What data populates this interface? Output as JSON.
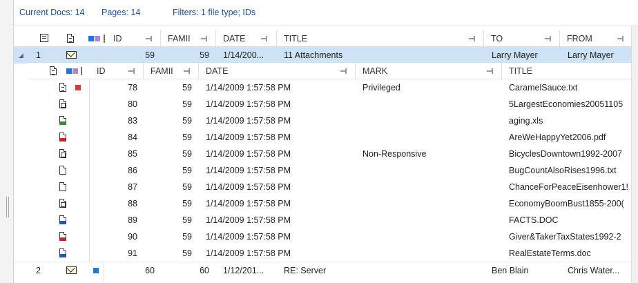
{
  "status": {
    "current_docs": "Current Docs: 14",
    "pages": "Pages: 14",
    "filters": "Filters: 1 file type; IDs"
  },
  "columns": {
    "id": "ID",
    "family": "FAMII",
    "date": "DATE",
    "title": "TITLE",
    "to": "TO",
    "from": "FROM"
  },
  "child_columns": {
    "id": "ID",
    "family": "FAMII",
    "date": "DATE",
    "mark": "MARK",
    "title": "TITLE"
  },
  "parent_rows": [
    {
      "row_num": "1",
      "id": "59",
      "family": "59",
      "date": "1/14/200...",
      "title": "11 Attachments",
      "to": "Larry Mayer",
      "from": "Larry Mayer",
      "expanded": true,
      "icon": "envelope-icon"
    },
    {
      "row_num": "2",
      "id": "60",
      "family": "60",
      "date": "1/12/201...",
      "title": "RE: Server",
      "to": "Ben Blain",
      "from": "Chris Water...",
      "expanded": false,
      "icon": "envelope-icon",
      "tag_color": "#1e78d8"
    }
  ],
  "child_rows": [
    {
      "id": "78",
      "family": "59",
      "date": "1/14/2009 1:57:58 PM",
      "mark": "Privileged",
      "title": "CaramelSauce.txt",
      "icon": "text-doc-icon",
      "tag_color": "#d83a3a"
    },
    {
      "id": "80",
      "family": "59",
      "date": "1/14/2009 1:57:58 PM",
      "mark": "",
      "title": "5LargestEconomies20051105",
      "icon": "image-doc-icon"
    },
    {
      "id": "83",
      "family": "59",
      "date": "1/14/2009 1:57:58 PM",
      "mark": "",
      "title": "aging.xls",
      "icon": "spreadsheet-icon"
    },
    {
      "id": "84",
      "family": "59",
      "date": "1/14/2009 1:57:58 PM",
      "mark": "",
      "title": "AreWeHappyYet2006.pdf",
      "icon": "pdf-icon"
    },
    {
      "id": "85",
      "family": "59",
      "date": "1/14/2009 1:57:58 PM",
      "mark": "Non-Responsive",
      "title": "BicyclesDowntown1992-2007",
      "icon": "image-doc-icon"
    },
    {
      "id": "86",
      "family": "59",
      "date": "1/14/2009 1:57:58 PM",
      "mark": "",
      "title": "BugCountAlsoRises1996.txt",
      "icon": "text-doc-icon"
    },
    {
      "id": "87",
      "family": "59",
      "date": "1/14/2009 1:57:58 PM",
      "mark": "",
      "title": "ChanceForPeaceEisenhower1!",
      "icon": "text-doc-icon"
    },
    {
      "id": "88",
      "family": "59",
      "date": "1/14/2009 1:57:58 PM",
      "mark": "",
      "title": "EconomyBoomBust1855-200(",
      "icon": "image-doc-icon"
    },
    {
      "id": "89",
      "family": "59",
      "date": "1/14/2009 1:57:58 PM",
      "mark": "",
      "title": "FACTS.DOC",
      "icon": "word-doc-icon"
    },
    {
      "id": "90",
      "family": "59",
      "date": "1/14/2009 1:57:58 PM",
      "mark": "",
      "title": "Giver&TakerTaxStates1992-2",
      "icon": "pdf-icon"
    },
    {
      "id": "91",
      "family": "59",
      "date": "1/14/2009 1:57:58 PM",
      "mark": "",
      "title": "RealEstateTerms.doc",
      "icon": "word-doc-icon"
    }
  ],
  "colors": {
    "accent": "#1e4f8c",
    "selected_row": "#cde3f5",
    "tag_blue": "#1e78d8",
    "tag_red": "#d83a3a",
    "tag_purple": "#a78bd8"
  }
}
